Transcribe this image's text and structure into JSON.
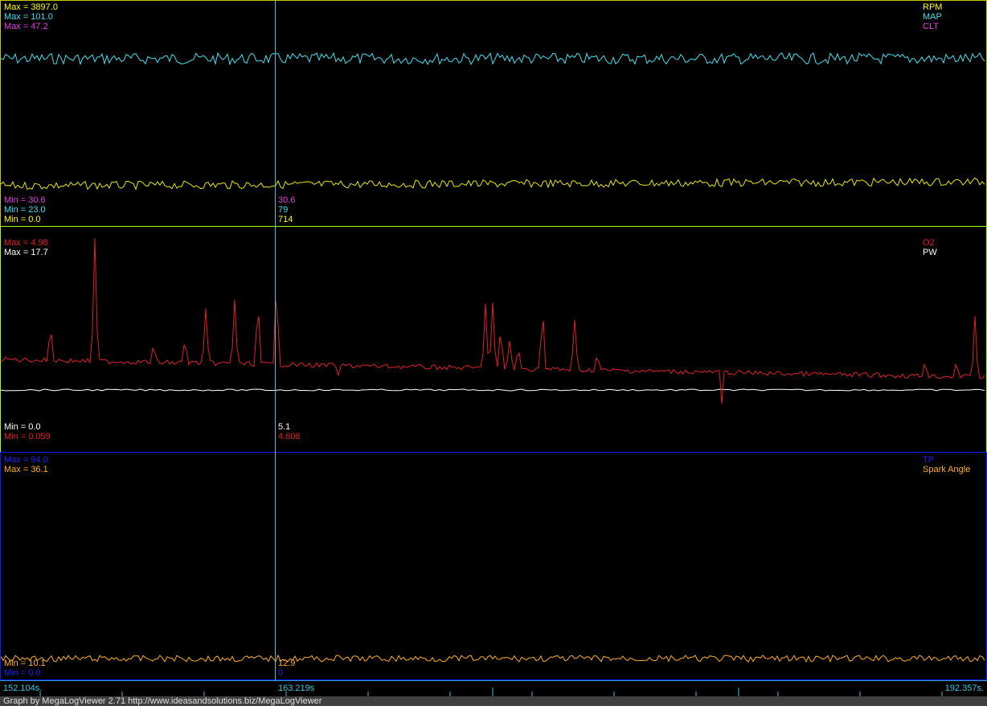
{
  "panel1": {
    "max_labels": [
      {
        "text": "Max = 3897.0",
        "color": "#ffff00"
      },
      {
        "text": "Max = 101.0",
        "color": "#40e0f0"
      },
      {
        "text": "Max = 47.2",
        "color": "#e040e0"
      }
    ],
    "names": [
      {
        "text": "RPM",
        "color": "#ffff00"
      },
      {
        "text": "MAP",
        "color": "#40e0f0"
      },
      {
        "text": "CLT",
        "color": "#e040e0"
      }
    ],
    "min_labels": [
      {
        "text": "Min = 30.6",
        "color": "#e040e0"
      },
      {
        "text": "Min = 23.0",
        "color": "#40e0f0"
      },
      {
        "text": "Min = 0.0",
        "color": "#ffff00"
      }
    ],
    "cursor_values": [
      {
        "text": "30.6",
        "color": "#e040e0"
      },
      {
        "text": "79",
        "color": "#40e0f0"
      },
      {
        "text": "714",
        "color": "#ffff00"
      }
    ]
  },
  "panel2": {
    "max_labels": [
      {
        "text": "Max = 4.98",
        "color": "#e02020"
      },
      {
        "text": "Max = 17.7",
        "color": "#ffffff"
      }
    ],
    "names": [
      {
        "text": "O2",
        "color": "#e02020"
      },
      {
        "text": "PW",
        "color": "#ffffff"
      }
    ],
    "min_labels": [
      {
        "text": "Min = 0.0",
        "color": "#ffffff"
      },
      {
        "text": "Min = 0.059",
        "color": "#e02020"
      }
    ],
    "cursor_values": [
      {
        "text": "5.1",
        "color": "#ffffff"
      },
      {
        "text": "4.608",
        "color": "#e02020"
      }
    ]
  },
  "panel3": {
    "max_labels": [
      {
        "text": "Max = 94.0",
        "color": "#2020ff"
      },
      {
        "text": "Max = 36.1",
        "color": "#ffb020"
      }
    ],
    "names": [
      {
        "text": "TP",
        "color": "#2020ff"
      },
      {
        "text": "Spark Angle",
        "color": "#ffb020"
      }
    ],
    "min_labels": [
      {
        "text": "Min = 10.1",
        "color": "#ffb020"
      },
      {
        "text": "Min = 0.0",
        "color": "#2020ff"
      }
    ],
    "cursor_values": [
      {
        "text": "12.9",
        "color": "#ffb020"
      },
      {
        "text": "0",
        "color": "#2020ff"
      }
    ]
  },
  "timebar": {
    "start": "152.104s.",
    "cursor": "163.219s",
    "end": "192.357s."
  },
  "footer": "Graph by MegaLogViewer 2.71 http://www.ideasandsolutions.biz/MegaLogViewer"
}
